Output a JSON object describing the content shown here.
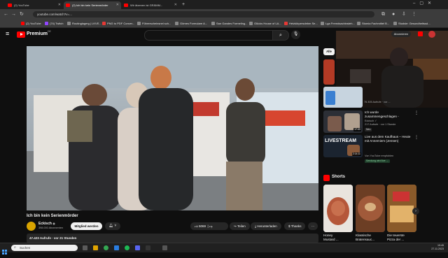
{
  "browser": {
    "tabs": [
      {
        "label": "(2) YouTube"
      },
      {
        "label": "(2) Ich bin kein Serienmörder"
      },
      {
        "label": "Wir ätzenen ist GRÄMM..."
      }
    ],
    "url": "youtube.com/watch?v=...",
    "bookmarks": [
      "(2) YouTube",
      "(74) Twitch",
      "Routinglagerg | LKVE...",
      "PNG to PDF Conver...",
      "Führerscheinsnel sch...",
      "Gömes Formulare A...",
      "San Gandes Formeling...",
      "Glücks House of LA...",
      "Heizkörpersdebm Se...",
      "Lga Fremdsachinsteh...",
      "Stomia Fachmittel B...",
      "Studsie: Gesundheitssd..."
    ]
  },
  "youtube": {
    "brand": "Premium",
    "brand_sup": "DE",
    "video": {
      "title": "Ich bin kein Serienmörder",
      "channel": "Eckisch",
      "channel_verified": "◉",
      "subscribers": "398.000 Abonnenten",
      "member_button": "Mitglied werden",
      "likes": "5069",
      "share": "Teilen",
      "download": "Herunterladen",
      "thanks": "Thanks",
      "views_line": "47.423 Aufrufe · vor 21 Stunden"
    },
    "chips": [
      "Alle"
    ],
    "sidebar": [
      {
        "title": "",
        "meta": "76.305 Aufrufe · vor ...",
        "duration": ""
      },
      {
        "title": "Ich wurde",
        "title2": "zusammengeschlagen -",
        "channel": "Eckisch ✓",
        "meta": "217 Aufrufe · vor 1 Stunde",
        "badge": "Neu",
        "duration": "17:40"
      },
      {
        "title": "Live aus dem Kaufhaus – Heute",
        "title2": "mit Annemiem (Jensen)",
        "channel": "Von YouTube empfohlen",
        "badge": "Sendung wird live ...",
        "thumb_text": "LIVESTREAM",
        "duration": "2:14:11"
      }
    ],
    "shorts": {
      "heading": "Shorts",
      "items": [
        {
          "title": "Honey",
          "title2": "Mustard ..."
        },
        {
          "title": "Klassische",
          "title2": "Bratensauc..."
        },
        {
          "title": "Die teuerste",
          "title2": "Pizza der ..."
        }
      ]
    },
    "pip_subscribe": "Abonnieren"
  },
  "taskbar": {
    "search_placeholder": "Suchen",
    "time": "19:45",
    "date": "27.11.2023"
  },
  "colors": {
    "accent": "#ff0000",
    "bg": "#0f0f0f",
    "chip": "#272727"
  }
}
